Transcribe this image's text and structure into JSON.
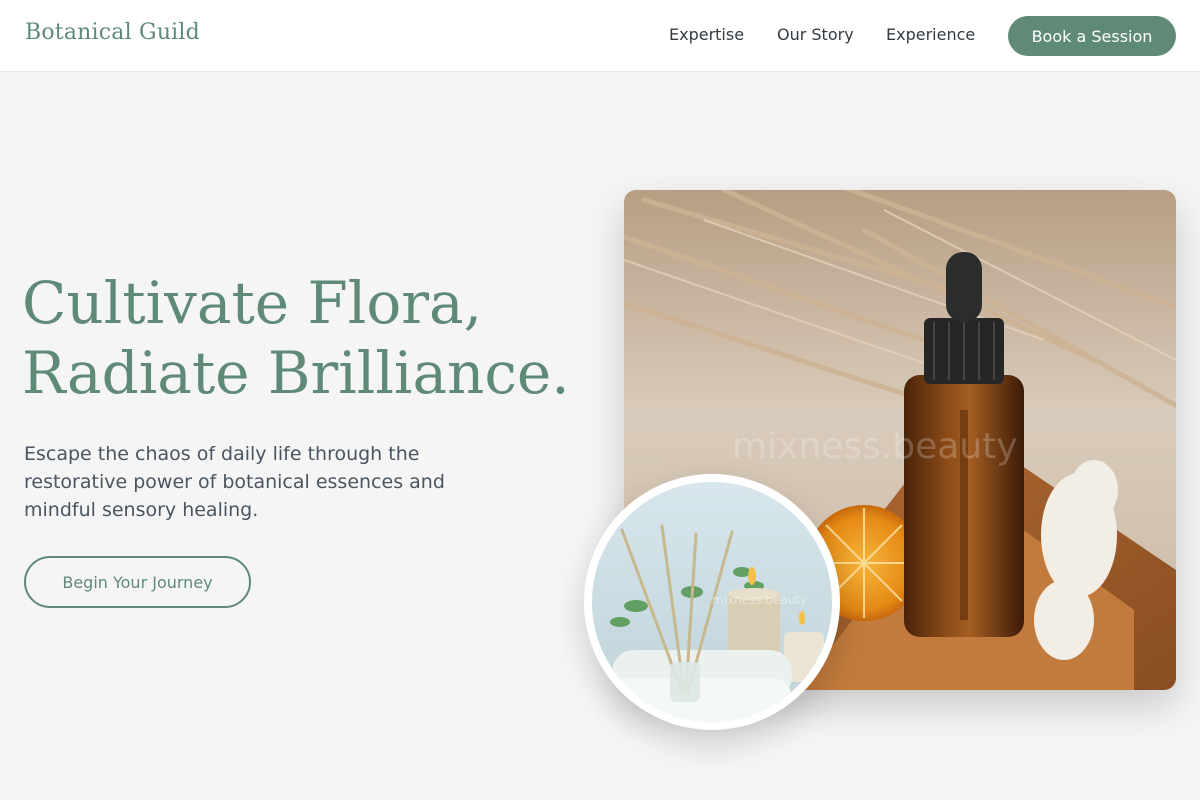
{
  "header": {
    "brand": "Botanical Guild",
    "nav": [
      {
        "label": "Expertise"
      },
      {
        "label": "Our Story"
      },
      {
        "label": "Experience"
      }
    ],
    "cta_label": "Book a Session"
  },
  "hero": {
    "title_line1": "Cultivate Flora,",
    "title_line2": "Radiate Brilliance.",
    "subtitle": "Escape the chaos of daily life through the restorative power of botanical essences and mindful sensory healing.",
    "cta_label": "Begin Your Journey"
  },
  "images": {
    "main": {
      "subject": "amber-dropper-bottle-with-orange-and-dried-grass",
      "watermark": "mixness.beauty"
    },
    "inset": {
      "subject": "reed-diffuser-candles-and-towels",
      "watermark": "mixness.beauty"
    }
  },
  "colors": {
    "accent": "#5f8a78",
    "background": "#f5f5f5",
    "header_bg": "#ffffff",
    "body_text": "#4a5560",
    "nav_text": "#333a40"
  }
}
